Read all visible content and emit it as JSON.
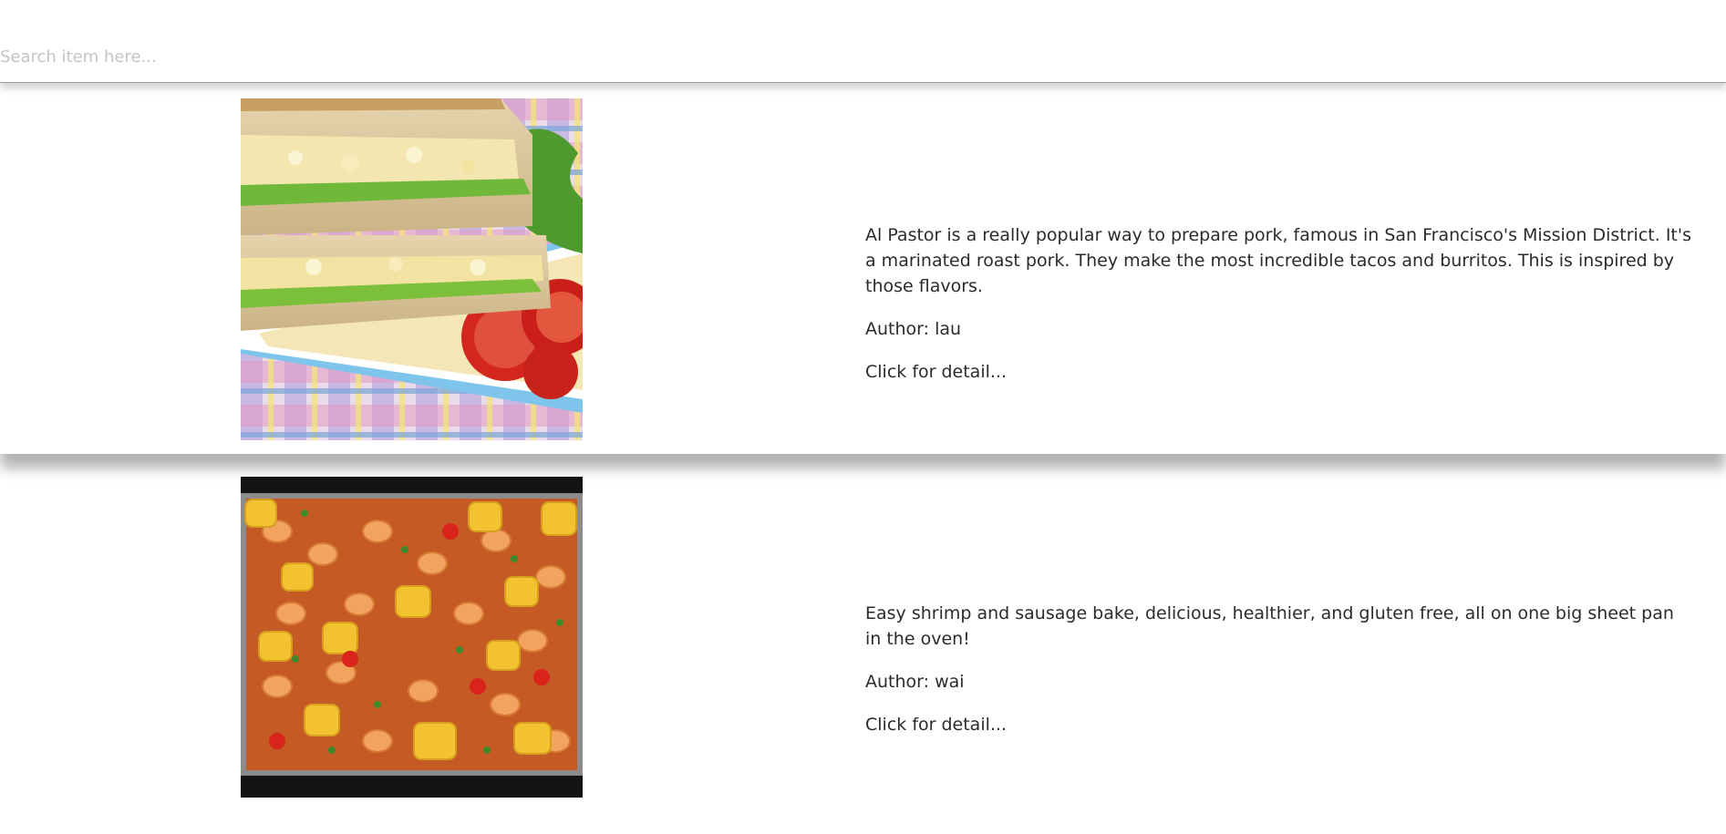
{
  "search": {
    "placeholder": "Search item here...",
    "value": ""
  },
  "recipes": [
    {
      "description": "Al Pastor is a really popular way to prepare pork, famous in San Francisco's Mission District. It's a marinated roast pork. They make the most incredible tacos and burritos. This is inspired by those flavors.",
      "author": "Author: lau",
      "detail_link": "Click for detail..."
    },
    {
      "description": "Easy shrimp and sausage bake, delicious, healthier, and gluten free, all on one big sheet pan in the oven!",
      "author": "Author: wai",
      "detail_link": "Click for detail..."
    }
  ]
}
